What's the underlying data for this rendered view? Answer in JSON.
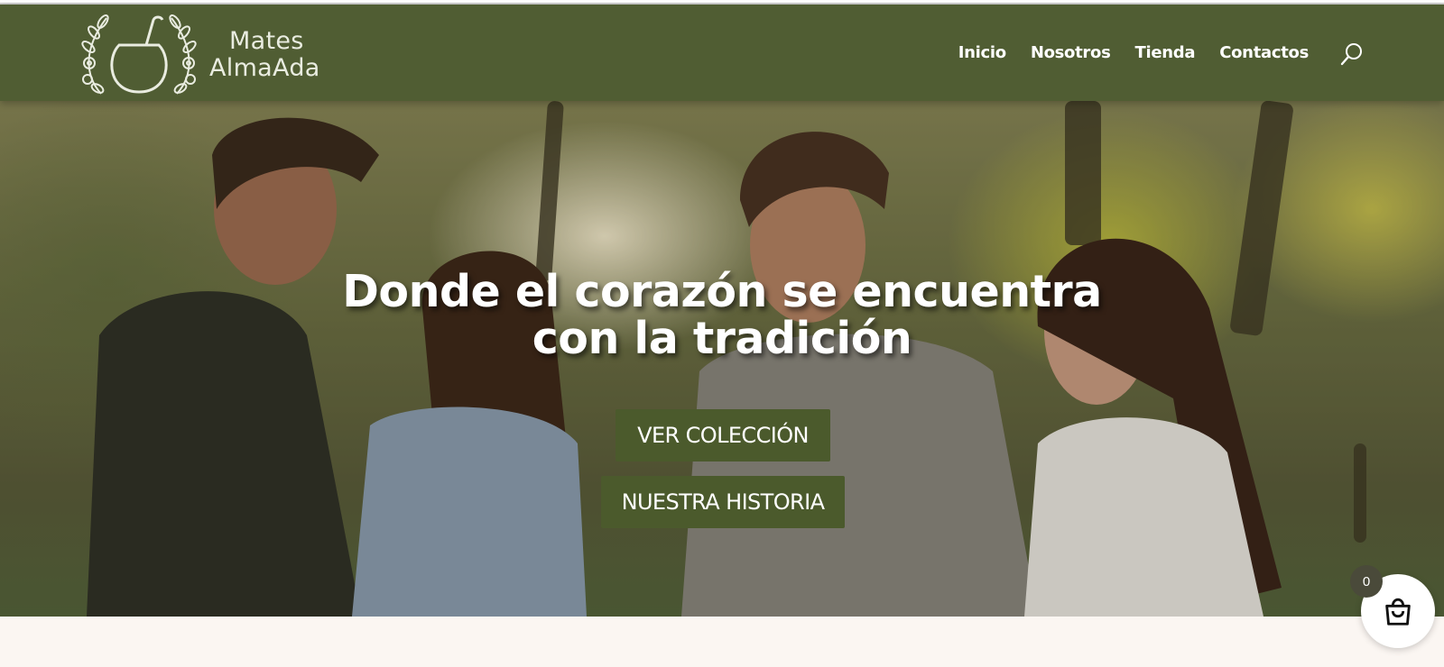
{
  "brand": {
    "line1": "Mates",
    "line2": "AlmaAda",
    "logo_icon": "mate-gourd-icon"
  },
  "nav": {
    "items": [
      {
        "label": "Inicio"
      },
      {
        "label": "Nosotros"
      },
      {
        "label": "Tienda"
      },
      {
        "label": "Contactos"
      }
    ],
    "search_icon": "search-icon"
  },
  "hero": {
    "headline_line1": "Donde el corazón se encuentra",
    "headline_line2": "con la tradición",
    "buttons": {
      "primary": "VER COLECCIÓN",
      "secondary": "NUESTRA HISTORIA"
    }
  },
  "cart": {
    "count": "0",
    "icon": "shopping-bag-icon"
  },
  "colors": {
    "header_bg": "#505d33",
    "button_bg": "#4b5a2c",
    "page_bg": "#fbf6f2"
  }
}
